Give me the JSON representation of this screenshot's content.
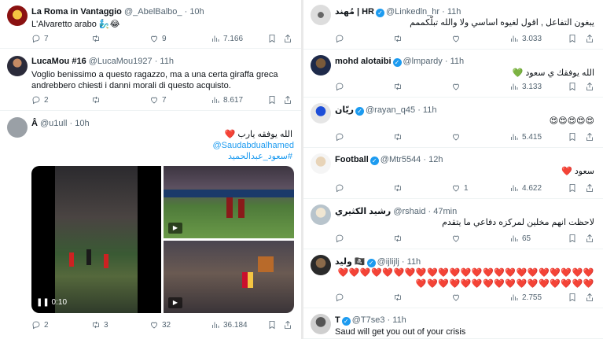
{
  "left": [
    {
      "name": "La Roma in Vantaggio",
      "handle": "@_AbelBalbo_",
      "time": "· 10h",
      "verified": false,
      "text": "L'Alvaretto arabo 🧞‍♂️😂",
      "replies": "7",
      "retweets": "",
      "likes": "9",
      "views": "7.166"
    },
    {
      "name": "LucaMou #16",
      "handle": "@LucaMou1927",
      "time": "· 11h",
      "verified": false,
      "text": "Voglio benissimo a questo ragazzo, ma a una certa giraffa greca andrebbero chiesti i danni morali di questo acquisto.",
      "replies": "2",
      "retweets": "",
      "likes": "7",
      "views": "8.617"
    },
    {
      "name": "Â",
      "handle": "@u1ull",
      "time": "· 10h",
      "verified": false,
      "text": "الله يوفقه يارب ❤️",
      "mention": "@Saudabdualhamed",
      "hashtag": "#سعود_عبدالحميد",
      "video_time": "0:10",
      "replies": "2",
      "retweets": "3",
      "likes": "32",
      "views": "36.184"
    }
  ],
  "right": [
    {
      "name": "مُهند | HR",
      "handle": "@Linkedln_hr",
      "time": "· 11h",
      "verified": true,
      "text": "يبغون التفاعل , اقول لغيوه اساسي ولا والله تبلّكممم",
      "replies": "",
      "retweets": "",
      "likes": "",
      "views": "3.033"
    },
    {
      "name": "mohd alotaibi",
      "handle": "@lmpardy",
      "time": "· 11h",
      "verified": true,
      "text": "الله يوفقك ي سعود 💚",
      "replies": "",
      "retweets": "",
      "likes": "",
      "views": "3.133"
    },
    {
      "name": "ريّان",
      "handle": "@rayan_q45",
      "time": "· 11h",
      "verified": true,
      "text": "😍😍😍😍😍",
      "replies": "",
      "retweets": "",
      "likes": "",
      "views": "5.415"
    },
    {
      "name": "Football",
      "handle": "@Mtr5544",
      "time": "· 12h",
      "verified": true,
      "text": "سعود ❤️",
      "replies": "",
      "retweets": "",
      "likes": "1",
      "views": "4.622"
    },
    {
      "name": "رشيد الكثيري",
      "handle": "@rshaid",
      "time": "· 47min",
      "verified": false,
      "text": "لاحظت انهم مخلين لمركزه دفاعي ما يتقدم",
      "replies": "",
      "retweets": "",
      "likes": "",
      "views": "65"
    },
    {
      "name": "وليد 🏴‍☠️",
      "handle": "@ijlijlj",
      "time": "· 11h",
      "verified": true,
      "text": "❤️❤️❤️❤️❤️❤️❤️❤️❤️❤️❤️❤️❤️❤️❤️❤️❤️❤️❤️❤️❤️❤️❤️❤️❤️❤️❤️❤️❤️❤️❤️❤️❤️❤️❤️❤️❤️❤️❤️",
      "replies": "",
      "retweets": "",
      "likes": "",
      "views": "2.755"
    },
    {
      "name": "T",
      "handle": "@T7se3",
      "time": "· 11h",
      "verified": true,
      "text": "Saud will get you out of your crisis",
      "replies": "",
      "retweets": "",
      "likes": "",
      "views": ""
    }
  ],
  "colors": {
    "accent": "#1d9bf0",
    "heart": "#f91880",
    "muted": "#536471"
  }
}
